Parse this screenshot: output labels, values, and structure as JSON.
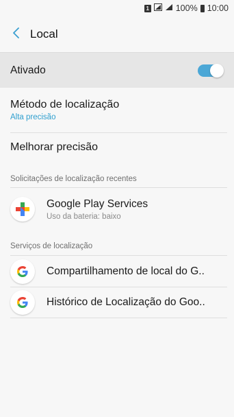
{
  "status_bar": {
    "sim_label": "1",
    "battery": "100%",
    "time": "10:00"
  },
  "app_bar": {
    "title": "Local"
  },
  "toggle": {
    "label": "Ativado",
    "enabled": true,
    "accent_color": "#4ba7d6"
  },
  "settings": {
    "method_title": "Método de localização",
    "method_value": "Alta precisão",
    "improve_title": "Melhorar precisão"
  },
  "recent_requests": {
    "header": "Solicitações de localização recentes",
    "items": [
      {
        "name": "Google Play Services",
        "sub": "Uso da bateria: baixo",
        "icon": "google-play-services-icon"
      }
    ]
  },
  "location_services": {
    "header": "Serviços de localização",
    "items": [
      {
        "name": "Compartilhamento de local do G..",
        "icon": "google-icon"
      },
      {
        "name": "Histórico de Localização do Goo..",
        "icon": "google-icon"
      }
    ]
  }
}
